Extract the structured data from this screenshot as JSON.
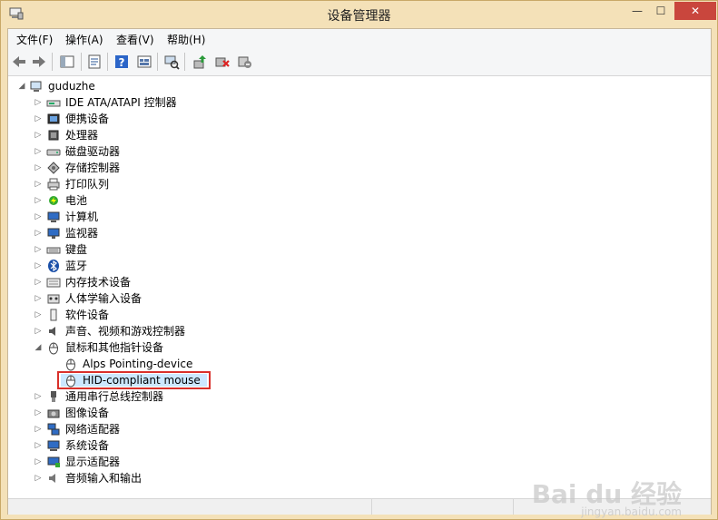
{
  "window": {
    "title": "设备管理器",
    "min_glyph": "—",
    "max_glyph": "☐",
    "close_glyph": "✕"
  },
  "menu": [
    "文件(F)",
    "操作(A)",
    "查看(V)",
    "帮助(H)"
  ],
  "toolbar": [
    "back-icon",
    "forward-icon",
    "show-hide-tree-icon",
    "properties-icon",
    "help-icon",
    "view-icon",
    "scan-hardware-icon",
    "update-driver-icon",
    "disable-device-icon",
    "uninstall-device-icon"
  ],
  "tree": {
    "root": "guduzhe",
    "categories": [
      {
        "label": "IDE ATA/ATAPI 控制器",
        "icon": "ide-controller-icon"
      },
      {
        "label": "便携设备",
        "icon": "portable-device-icon"
      },
      {
        "label": "处理器",
        "icon": "processor-icon"
      },
      {
        "label": "磁盘驱动器",
        "icon": "disk-drive-icon"
      },
      {
        "label": "存储控制器",
        "icon": "storage-controller-icon"
      },
      {
        "label": "打印队列",
        "icon": "printer-icon"
      },
      {
        "label": "电池",
        "icon": "battery-icon"
      },
      {
        "label": "计算机",
        "icon": "computer-icon"
      },
      {
        "label": "监视器",
        "icon": "monitor-icon"
      },
      {
        "label": "键盘",
        "icon": "keyboard-icon"
      },
      {
        "label": "蓝牙",
        "icon": "bluetooth-icon"
      },
      {
        "label": "内存技术设备",
        "icon": "memory-device-icon"
      },
      {
        "label": "人体学输入设备",
        "icon": "hid-icon"
      },
      {
        "label": "软件设备",
        "icon": "software-device-icon"
      },
      {
        "label": "声音、视频和游戏控制器",
        "icon": "sound-icon"
      },
      {
        "label": "鼠标和其他指针设备",
        "icon": "mouse-icon",
        "expanded": true,
        "children": [
          {
            "label": "Alps Pointing-device",
            "icon": "mouse-icon"
          },
          {
            "label": "HID-compliant mouse",
            "icon": "mouse-icon",
            "selected": true
          }
        ]
      },
      {
        "label": "通用串行总线控制器",
        "icon": "usb-icon"
      },
      {
        "label": "图像设备",
        "icon": "imaging-device-icon"
      },
      {
        "label": "网络适配器",
        "icon": "network-adapter-icon"
      },
      {
        "label": "系统设备",
        "icon": "system-device-icon"
      },
      {
        "label": "显示适配器",
        "icon": "display-adapter-icon"
      },
      {
        "label": "音频输入和输出",
        "icon": "audio-io-icon"
      }
    ]
  },
  "watermark": {
    "text": "Bai du 经验",
    "url": "jingyan.baidu.com"
  }
}
